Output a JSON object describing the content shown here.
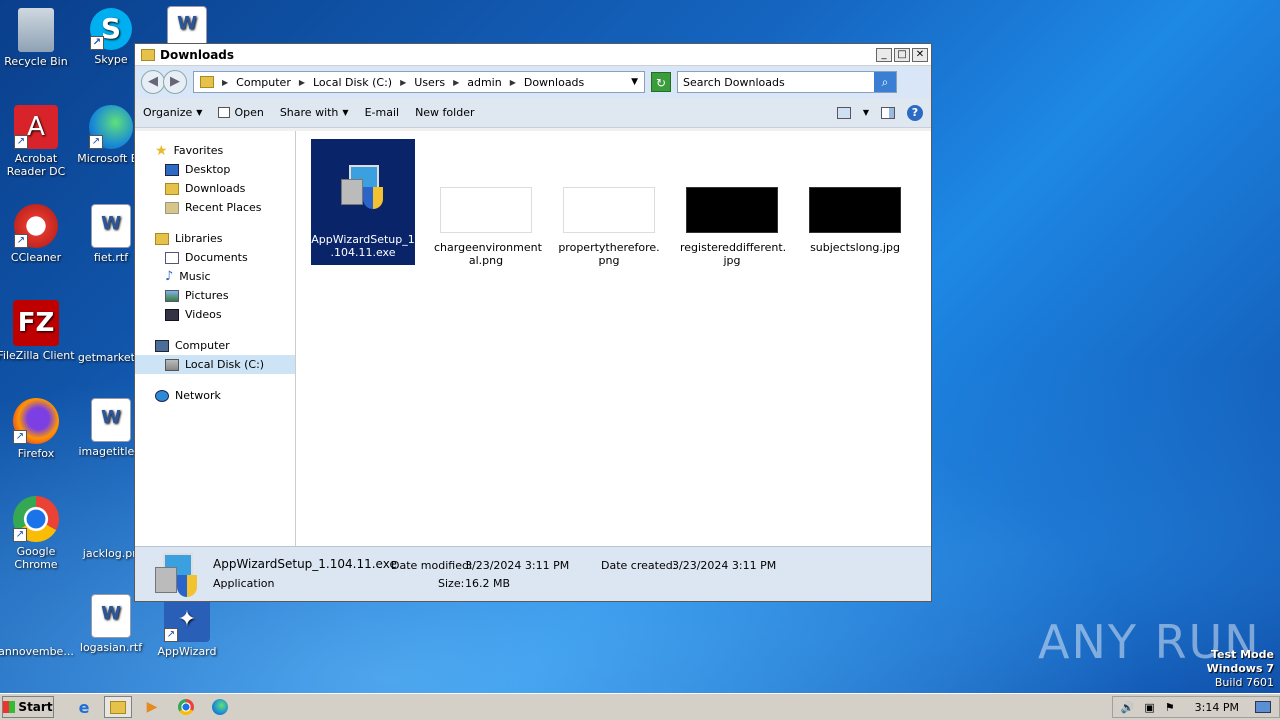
{
  "desktop": {
    "icons": [
      {
        "label": "Recycle Bin"
      },
      {
        "label": "Skype"
      },
      {
        "label": "Acrobat Reader DC"
      },
      {
        "label": "Microsoft Ed"
      },
      {
        "label": "CCleaner"
      },
      {
        "label": "fiet.rtf"
      },
      {
        "label": "FileZilla Client"
      },
      {
        "label": "getmarkets."
      },
      {
        "label": "Firefox"
      },
      {
        "label": "imagetitles."
      },
      {
        "label": "Google Chrome"
      },
      {
        "label": "jacklog.pn"
      },
      {
        "label": "annovembe..."
      },
      {
        "label": "logasian.rtf"
      },
      {
        "label": "AppWizard"
      }
    ]
  },
  "window": {
    "title": "Downloads",
    "breadcrumb": [
      "Computer",
      "Local Disk (C:)",
      "Users",
      "admin",
      "Downloads"
    ],
    "search_placeholder": "Search Downloads",
    "toolbar": {
      "organize": "Organize",
      "open": "Open",
      "share_with": "Share with",
      "email": "E-mail",
      "new_folder": "New folder"
    },
    "nav": {
      "favorites": "Favorites",
      "desktop": "Desktop",
      "downloads": "Downloads",
      "recent_places": "Recent Places",
      "libraries": "Libraries",
      "documents": "Documents",
      "music": "Music",
      "pictures": "Pictures",
      "videos": "Videos",
      "computer": "Computer",
      "local_disk": "Local Disk (C:)",
      "network": "Network"
    },
    "files": [
      {
        "name": "AppWizardSetup_1.104.11.exe",
        "name_line1": "AppWizardSetup_1",
        "name_line2": ".104.11.exe"
      },
      {
        "name": "chargeenvironmental.png",
        "name_line1": "chargeenvironment",
        "name_line2": "al.png"
      },
      {
        "name": "propertytherefore.png",
        "name_line1": "propertytherefore.",
        "name_line2": "png"
      },
      {
        "name": "registereddifferent.jpg",
        "name_line1": "registereddifferent.",
        "name_line2": "jpg"
      },
      {
        "name": "subjectslong.jpg",
        "name_line1": "subjectslong.jpg",
        "name_line2": ""
      }
    ],
    "details": {
      "name": "AppWizardSetup_1.104.11.exe",
      "type": "Application",
      "date_modified_label": "Date modified:",
      "date_modified": "3/23/2024 3:11 PM",
      "date_created_label": "Date created:",
      "date_created": "3/23/2024 3:11 PM",
      "size_label": "Size:",
      "size": "16.2 MB"
    }
  },
  "watermark": {
    "brand": "ANY RUN",
    "test_mode": "Test Mode",
    "os": "Windows 7",
    "build": "Build 7601"
  },
  "taskbar": {
    "start": "Start",
    "clock": "3:14 PM"
  }
}
